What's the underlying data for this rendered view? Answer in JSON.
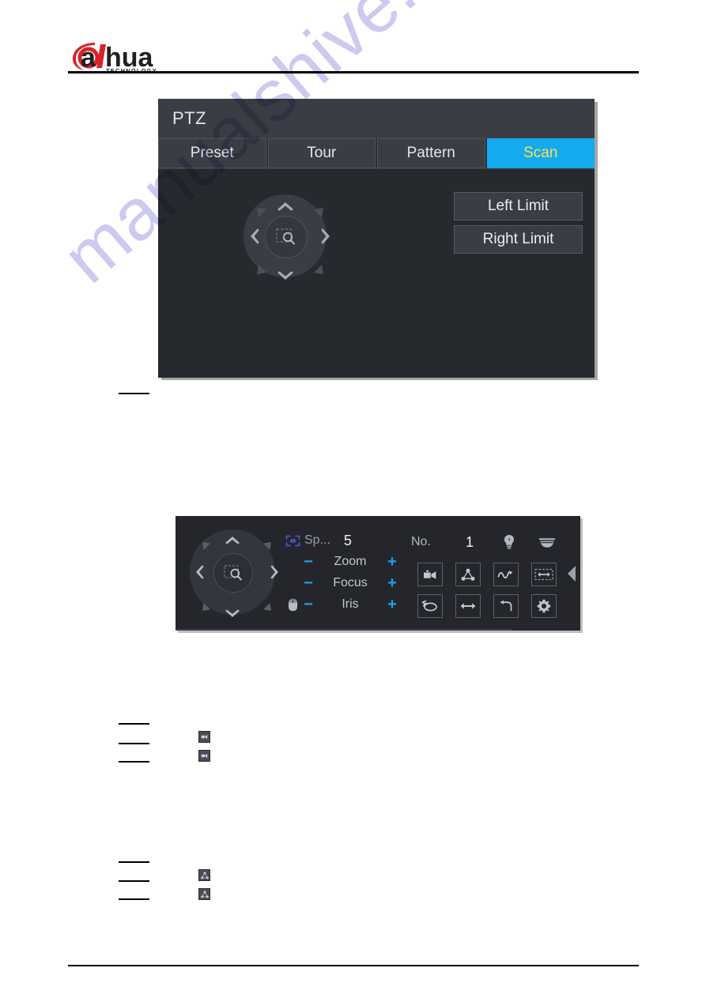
{
  "document": {
    "brand_name": "alhua",
    "brand_sub": "TECHNOLOGY"
  },
  "ptz_dialog": {
    "title": "PTZ",
    "tabs": [
      {
        "label": "Preset",
        "active": false
      },
      {
        "label": "Tour",
        "active": false
      },
      {
        "label": "Pattern",
        "active": false
      },
      {
        "label": "Scan",
        "active": true
      }
    ],
    "active_tab_bg": "#15aaf0",
    "active_tab_text_color": "#ffe14d",
    "buttons": [
      {
        "label": "Left Limit",
        "name": "left-limit-button"
      },
      {
        "label": "Right Limit",
        "name": "right-limit-button"
      }
    ],
    "direction_pad": {
      "center_icon": "zoom-area-icon",
      "directions": [
        "up",
        "down",
        "left",
        "right",
        "up-left",
        "up-right",
        "down-left",
        "down-right"
      ]
    }
  },
  "ptz_toolbar": {
    "direction_pad": {
      "center_icon": "zoom-area-icon"
    },
    "speed": {
      "icon": "expand-arrows-icon",
      "label": "Sp...",
      "value": "5"
    },
    "mouse_icon": "mouse-icon",
    "controls": [
      {
        "label": "Zoom",
        "minus": "−",
        "plus": "+"
      },
      {
        "label": "Focus",
        "minus": "−",
        "plus": "+"
      },
      {
        "label": "Iris",
        "minus": "−",
        "plus": "+"
      }
    ],
    "number": {
      "label": "No.",
      "value": "1"
    },
    "head_icons": [
      {
        "name": "light-bulb-icon"
      },
      {
        "name": "wiper-icon"
      }
    ],
    "action_buttons": [
      {
        "name": "preset-icon"
      },
      {
        "name": "tour-icon"
      },
      {
        "name": "pattern-icon"
      },
      {
        "name": "auto-scan-icon"
      },
      {
        "name": "auto-pan-icon"
      },
      {
        "name": "flip-icon"
      },
      {
        "name": "reset-icon"
      },
      {
        "name": "settings-gear-icon"
      }
    ],
    "collapse_icon": "collapse-left-arrow-icon",
    "accent_color": "#1f9ff0"
  },
  "watermark": {
    "text": "manualshive.com",
    "color": "#c9c7ef"
  },
  "body_icons": [
    {
      "name": "preset-icon"
    },
    {
      "name": "preset-icon"
    },
    {
      "name": "tour-icon"
    },
    {
      "name": "tour-icon"
    }
  ]
}
